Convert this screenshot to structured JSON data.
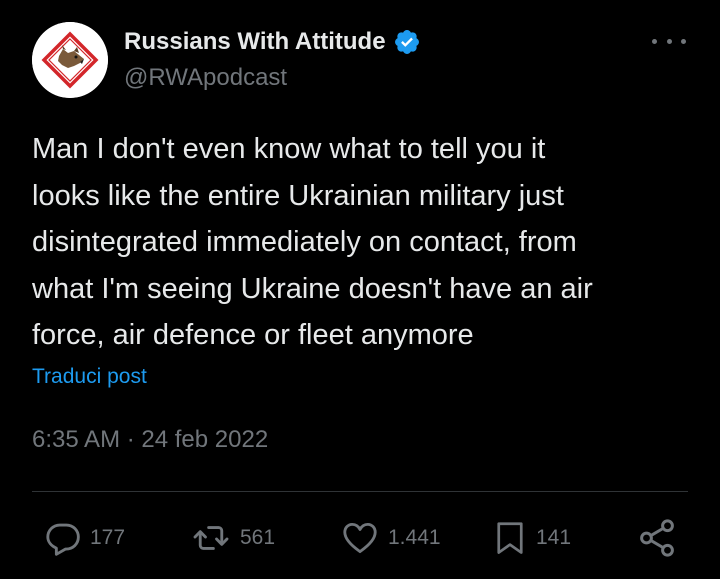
{
  "author": {
    "display_name": "Russians With Attitude",
    "handle": "@RWApodcast",
    "verified_color": "#1d9bf0"
  },
  "tweet": {
    "text": "Man I don't even know what to tell you it\nlooks like the entire Ukrainian military just\ndisintegrated immediately on contact, from\nwhat I'm seeing Ukraine doesn't have an air\nforce, air defence or fleet anymore",
    "translate_label": "Traduci post",
    "timestamp": "6:35 AM · 24 feb 2022"
  },
  "actions": {
    "replies": "177",
    "reposts": "561",
    "likes": "1.441",
    "bookmarks": "141"
  },
  "icons": {
    "more": "more-dots-icon",
    "reply": "reply-icon",
    "repost": "repost-icon",
    "like": "heart-icon",
    "bookmark": "bookmark-icon",
    "share": "share-icon",
    "verified": "verified-badge-icon"
  },
  "colors": {
    "background": "#000000",
    "text": "#e7e9ea",
    "secondary": "#71767b",
    "link": "#1d9bf0",
    "divider": "#2f3336"
  }
}
